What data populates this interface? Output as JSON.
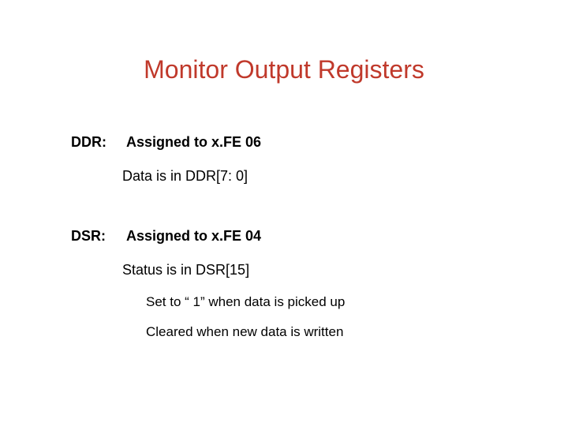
{
  "title": "Monitor Output Registers",
  "registers": [
    {
      "label": "DDR:",
      "assigned": "Assigned to x.FE 06",
      "detail": "Data is in DDR[7: 0]",
      "bullets": []
    },
    {
      "label": "DSR:",
      "assigned": "Assigned to x.FE 04",
      "detail": "Status is in DSR[15]",
      "bullets": [
        "Set to “ 1”  when data is picked up",
        "Cleared when new data is written"
      ]
    }
  ]
}
